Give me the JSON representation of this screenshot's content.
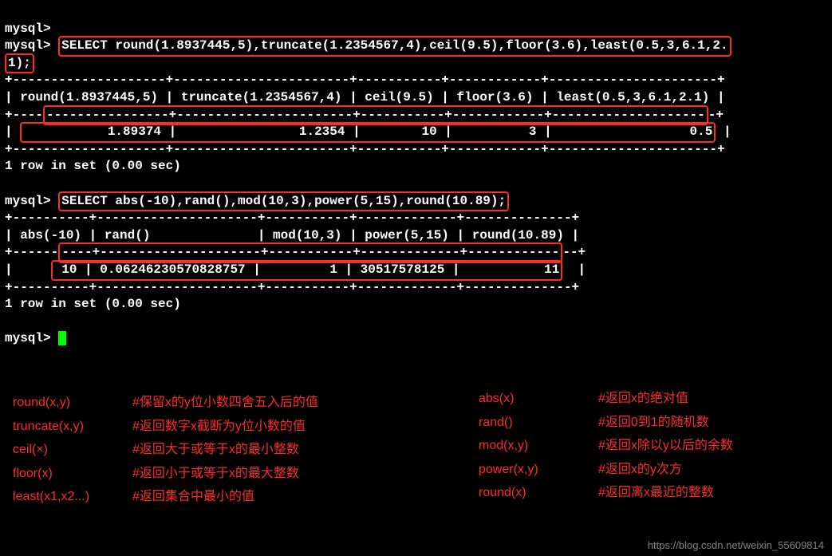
{
  "prompt": "mysql>",
  "query1": {
    "sql": "SELECT round(1.8937445,5),truncate(1.2354567,4),ceil(9.5),floor(3.6),least(0.5,3,6.1,2.1);",
    "sql_tail": "1);",
    "sep1": "+--------------------+-----------------------+-----------+------------+----------------------+",
    "header": "| round(1.8937445,5) | truncate(1.2354567,4) | ceil(9.5) | floor(3.6) | least(0.5,3,6.1,2.1) |",
    "sep2_left": "+----",
    "sep2_right": "-+",
    "sep2_mid": "----------------+-----------------------+-----------+------------+--------------------",
    "row_left": "| ",
    "row_mid": "           1.89374 |                1.2354 |        10 |          3 |                  0.5",
    "row_right": " |",
    "status": "1 row in set (0.00 sec)"
  },
  "query2": {
    "sql": "SELECT abs(-10),rand(),mod(10,3),power(5,15),round(10.89);",
    "sep1": "+----------+---------------------+-----------+-------------+--------------+",
    "header": "| abs(-10) | rand()              | mod(10,3) | power(5,15) | round(10.89) |",
    "sep2_left": "+------",
    "sep2_right": "--+",
    "sep2_mid": "----+---------------------+-----------+-------------+------------",
    "row_left": "|     ",
    "row_mid": " 10 | 0.06246230570828757 |         1 | 30517578125 |           11",
    "row_right": "  |",
    "status": "1 row in set (0.00 sec)"
  },
  "legend_left": [
    {
      "fn": "round(x,y)",
      "desc": "#保留x的y位小数四舍五入后的值"
    },
    {
      "fn": "truncate(x,y)",
      "desc": "#返回数字x截断为y位小数的值"
    },
    {
      "fn": "ceil(×)",
      "desc": "#返回大于或等于x的最小整数"
    },
    {
      "fn": "floor(x)",
      "desc": "#返回小于或等于x的最大整数"
    },
    {
      "fn": "least(x1,x2...)",
      "desc": "#返回集合中最小的值"
    }
  ],
  "legend_right": [
    {
      "fn": "abs(x)",
      "desc": "#返回x的绝对值"
    },
    {
      "fn": "rand()",
      "desc": "#返回0到1的随机数"
    },
    {
      "fn": "mod(x,y)",
      "desc": "#返回x除以y以后的余数"
    },
    {
      "fn": "power(x,y)",
      "desc": "#返回x的y次方"
    },
    {
      "fn": "round(x)",
      "desc": "#返回离x最近的整数"
    }
  ],
  "watermark": "https://blog.csdn.net/weixin_55609814"
}
